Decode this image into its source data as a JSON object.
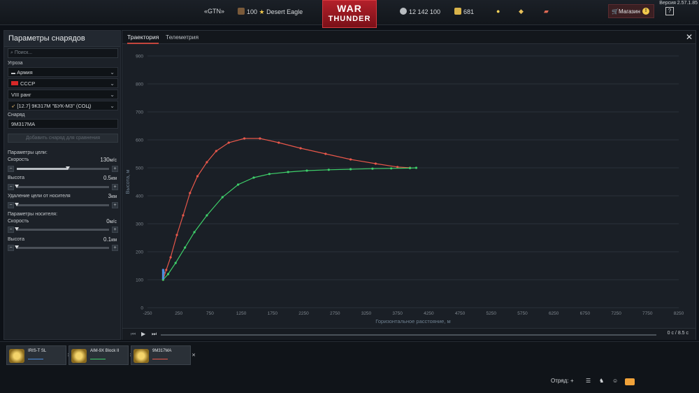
{
  "topbar": {
    "version": "Версия 2.57.1.85",
    "clan": "«GTN»",
    "level": "100",
    "nickname": "Desert Eagle",
    "logo_line1": "WAR",
    "logo_line2": "THUNDER",
    "silver_lions": "12 142 100",
    "golden_eagles": "681",
    "shop_label": "Магазин",
    "help_label": "?"
  },
  "panel": {
    "title": "Параметры снарядов",
    "search_placeholder": "Поиск...",
    "threat_label": "Угроза",
    "threat_type": "Армия",
    "country": "СССР",
    "rank": "VIII ранг",
    "weapon": "[12.7] 9К317М \"БУК-М3\" (СОЦ)",
    "shell_label": "Снаряд",
    "shell_value": "9М317МА",
    "add_shell_button": "Добавить снаряд для сравнения",
    "target_params_label": "Параметры цели:",
    "target_speed_label": "Скорость",
    "target_speed_value": "130",
    "target_speed_unit": "м/с",
    "target_speed_fraction": 0.55,
    "target_alt_label": "Высота",
    "target_alt_value": "0.5",
    "target_alt_unit": "км",
    "target_alt_fraction": 0.0,
    "target_dist_label": "Удаление цели от носителя",
    "target_dist_value": "3",
    "target_dist_unit": "км",
    "target_dist_fraction": 0.0,
    "carrier_params_label": "Параметры носителя:",
    "carrier_speed_label": "Скорость",
    "carrier_speed_value": "0",
    "carrier_speed_unit": "м/с",
    "carrier_speed_fraction": 0.0,
    "carrier_alt_label": "Высота",
    "carrier_alt_value": "0.1",
    "carrier_alt_unit": "км",
    "carrier_alt_fraction": 0.0
  },
  "tabs": {
    "trajectory": "Траектория",
    "telemetry": "Телеметрия"
  },
  "player": {
    "time": "0 с / 8.5 с",
    "progress": 0.0
  },
  "comparison": [
    {
      "name": "IRIS-T SL",
      "color": "#4d8fe0"
    },
    {
      "name": "AIM-9X Block II",
      "color": "#3ecf6a"
    },
    {
      "name": "9М317МА",
      "color": "#e8574a"
    }
  ],
  "tray": {
    "squad_label": "Отряд:"
  },
  "colors": {
    "accent": "#c4453d",
    "series_red": "#e8574a",
    "series_green": "#3ecf6a",
    "series_blue": "#4d8fe0"
  },
  "chart_data": {
    "type": "line",
    "xlabel": "Горизонтальное расстояние, м",
    "ylabel": "Высота, м",
    "xlim": [
      -250,
      8250
    ],
    "ylim": [
      0,
      900
    ],
    "xticks": [
      -250,
      250,
      750,
      1250,
      1750,
      2250,
      2750,
      3250,
      3750,
      4250,
      4750,
      5250,
      5750,
      6250,
      6750,
      7250,
      7750,
      8250
    ],
    "yticks": [
      0,
      100,
      200,
      300,
      400,
      500,
      600,
      700,
      800,
      900
    ],
    "grid": true,
    "series": [
      {
        "name": "9М317МА",
        "color": "#e8574a",
        "x": [
          0,
          50,
          120,
          220,
          320,
          430,
          550,
          700,
          850,
          1050,
          1300,
          1550,
          1850,
          2200,
          2600,
          3000,
          3400,
          3750,
          3950
        ],
        "y": [
          100,
          135,
          180,
          260,
          330,
          410,
          470,
          520,
          560,
          590,
          605,
          605,
          590,
          570,
          550,
          530,
          515,
          503,
          500
        ]
      },
      {
        "name": "AIM-9X Block II",
        "color": "#3ecf6a",
        "x": [
          0,
          80,
          200,
          350,
          500,
          700,
          950,
          1200,
          1450,
          1700,
          2000,
          2300,
          2650,
          3000,
          3350,
          3650,
          3950,
          4050
        ],
        "y": [
          100,
          120,
          160,
          215,
          270,
          330,
          395,
          440,
          465,
          478,
          485,
          490,
          493,
          495,
          497,
          498,
          499,
          500
        ]
      },
      {
        "name": "IRIS-T SL",
        "color": "#4d8fe0",
        "x": [
          0,
          0,
          10
        ],
        "y": [
          105,
          135,
          125
        ]
      }
    ]
  }
}
